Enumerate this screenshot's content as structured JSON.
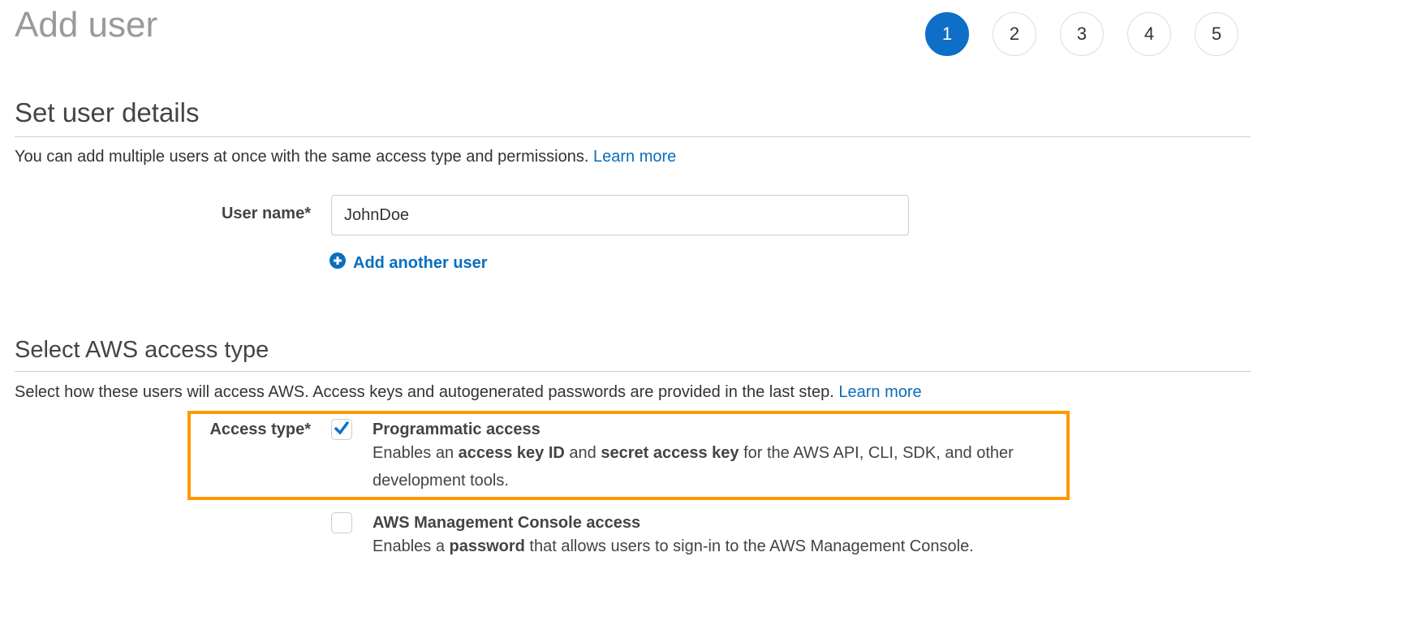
{
  "page_title": "Add user",
  "steps": [
    "1",
    "2",
    "3",
    "4",
    "5"
  ],
  "active_step": 1,
  "details": {
    "heading": "Set user details",
    "description": "You can add multiple users at once with the same access type and permissions.",
    "learn_more": "Learn more",
    "user_name_label": "User name*",
    "user_name_value": "JohnDoe",
    "add_another": "Add another user"
  },
  "access": {
    "heading": "Select AWS access type",
    "description": "Select how these users will access AWS. Access keys and autogenerated passwords are provided in the last step.",
    "learn_more": "Learn more",
    "label": "Access type*",
    "options": [
      {
        "title": "Programmatic access",
        "checked": true,
        "desc": [
          "Enables an ",
          "access key ID",
          " and ",
          "secret access key",
          " for the AWS API, CLI, SDK, and other development tools."
        ]
      },
      {
        "title": "AWS Management Console access",
        "checked": false,
        "desc": [
          "Enables a ",
          "password",
          " that allows users to sign-in to the AWS Management Console."
        ]
      }
    ]
  },
  "colors": {
    "accent": "#0f6fc6",
    "highlight": "#ff9900",
    "link": "#0a6ebd"
  }
}
